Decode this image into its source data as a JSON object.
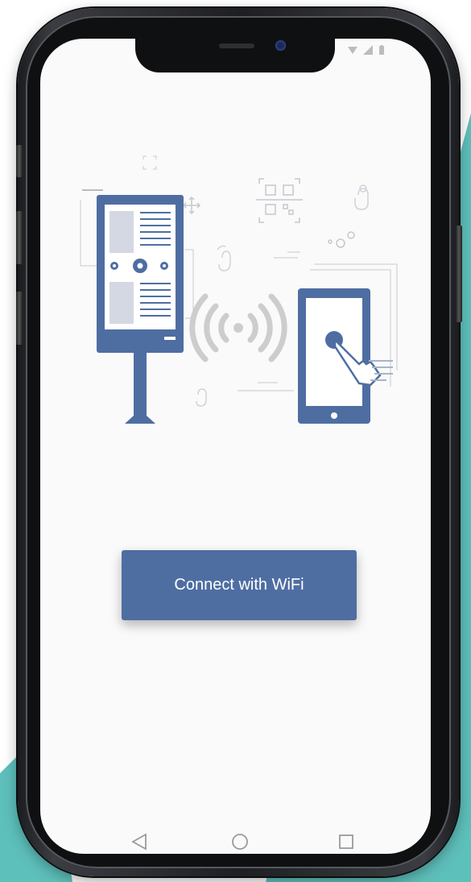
{
  "colors": {
    "accent": "#4e6ea2",
    "teal": "#5ec0bb",
    "screen_bg": "#fafafa",
    "illustration_gray": "#c8c8c8"
  },
  "status_bar": {
    "icons": [
      "wifi-icon",
      "signal-icon",
      "battery-icon"
    ]
  },
  "illustration": {
    "icons": [
      "kiosk-icon",
      "gear-icon",
      "wifi-signal-icon",
      "smartphone-icon",
      "hand-pointer-icon",
      "qr-code-icon"
    ]
  },
  "connect_button": {
    "label": "Connect with WiFi"
  },
  "nav_bar": {
    "items": [
      {
        "icon": "back-triangle-icon"
      },
      {
        "icon": "home-circle-icon"
      },
      {
        "icon": "recents-square-icon"
      }
    ]
  }
}
